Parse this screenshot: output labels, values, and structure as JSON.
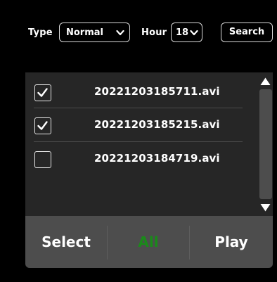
{
  "filters": {
    "type_label": "Type",
    "type_value": "Normal",
    "hour_label": "Hour",
    "hour_value": "18",
    "search_label": "Search"
  },
  "files": [
    {
      "name": "20221203185711.avi",
      "checked": true
    },
    {
      "name": "20221203185215.avi",
      "checked": true
    },
    {
      "name": "20221203184719.avi",
      "checked": false
    }
  ],
  "actions": {
    "select_label": "Select",
    "all_label": "All",
    "play_label": "Play"
  },
  "colors": {
    "background": "#000000",
    "list_background": "#262626",
    "bar_background": "#4d4d4d",
    "all_active": "#1a8a1a",
    "text": "#ffffff"
  }
}
